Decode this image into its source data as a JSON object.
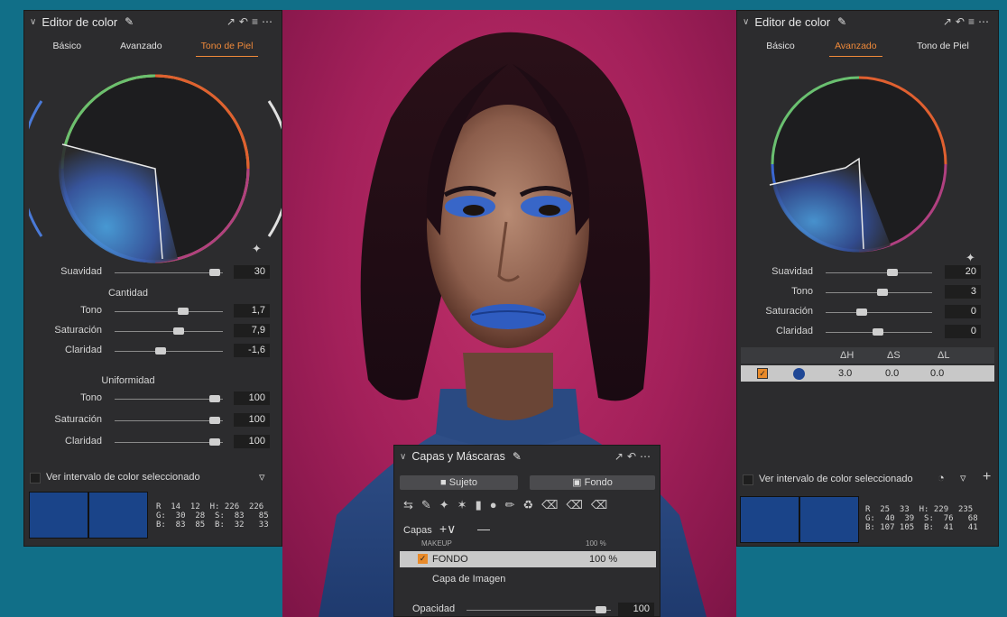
{
  "left_panel": {
    "title": "Editor de color",
    "tabs": [
      "Básico",
      "Avanzado",
      "Tono de Piel"
    ],
    "active_tab": "Tono de Piel",
    "suavidad": {
      "label": "Suavidad",
      "value": "30"
    },
    "cantidad": {
      "header": "Cantidad",
      "rows": [
        {
          "label": "Tono",
          "value": "1,7"
        },
        {
          "label": "Saturación",
          "value": "7,9"
        },
        {
          "label": "Claridad",
          "value": "-1,6"
        }
      ]
    },
    "uniformidad": {
      "header": "Uniformidad",
      "rows": [
        {
          "label": "Tono",
          "value": "100"
        },
        {
          "label": "Saturación",
          "value": "100"
        },
        {
          "label": "Claridad",
          "value": "100"
        }
      ]
    },
    "show_range": "Ver intervalo de color seleccionado",
    "readout": "R  14  12  H: 226  226\nG:  30  28  S:  83   85\nB:  83  85  B:  32   33"
  },
  "right_panel": {
    "title": "Editor de color",
    "tabs": [
      "Básico",
      "Avanzado",
      "Tono de Piel"
    ],
    "active_tab": "Avanzado",
    "sliders": [
      {
        "label": "Suavidad",
        "value": "20"
      },
      {
        "label": "Tono",
        "value": "3"
      },
      {
        "label": "Saturación",
        "value": "0"
      },
      {
        "label": "Claridad",
        "value": "0"
      }
    ],
    "table": {
      "headers": [
        "ΔH",
        "ΔS",
        "ΔL"
      ],
      "row": [
        "3.0",
        "0.0",
        "0.0"
      ]
    },
    "show_range": "Ver intervalo de color seleccionado",
    "readout": "R  25  33  H: 229  235\nG:  40  39  S:  76   68\nB: 107 105  B:  41   41"
  },
  "layers_panel": {
    "title": "Capas y Máscaras",
    "buttons": [
      "Sujeto",
      "Fondo"
    ],
    "capas_label": "Capas",
    "partial_row": "MAKEUP",
    "partial_pct": "100 %",
    "layer": {
      "name": "FONDO",
      "opacity": "100 %"
    },
    "image_layer": "Capa de Imagen",
    "opacidad": {
      "label": "Opacidad",
      "value": "100"
    }
  }
}
